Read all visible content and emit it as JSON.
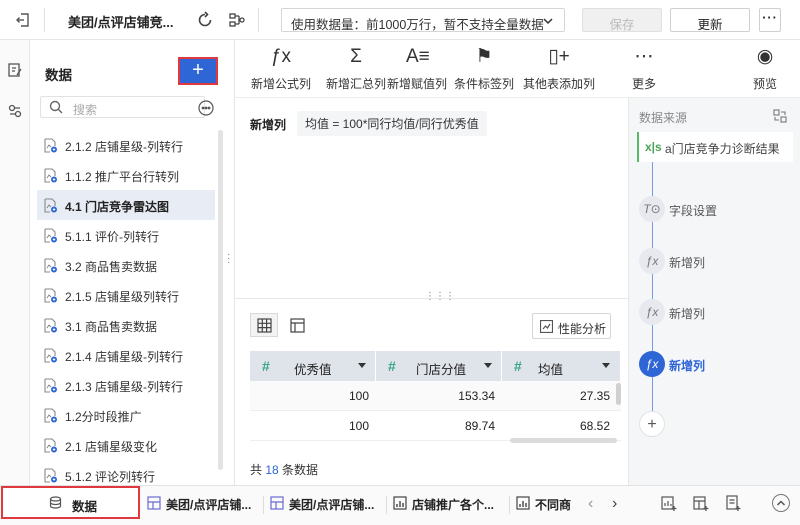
{
  "header": {
    "title": "美团/点评店铺竞...",
    "data_mode": "使用数据量：前1000万行，暂不支持全量数据",
    "save_label": "保存",
    "update_label": "更新",
    "more_label": "···"
  },
  "data_panel": {
    "heading": "数据",
    "add_label": "+",
    "search_placeholder": "搜索",
    "items": [
      {
        "label": "2.1.2 店铺星级-列转行"
      },
      {
        "label": "1.1.2 推广平台行转列"
      },
      {
        "label": "4.1 门店竞争雷达图"
      },
      {
        "label": "5.1.1 评价-列转行"
      },
      {
        "label": "3.2 商品售卖数据"
      },
      {
        "label": "2.1.5 店铺星级列转行"
      },
      {
        "label": "3.1 商品售卖数据"
      },
      {
        "label": "2.1.4 店铺星级-列转行"
      },
      {
        "label": "2.1.3 店铺星级-列转行"
      },
      {
        "label": "1.2分时段推广"
      },
      {
        "label": "2.1 店铺星级变化"
      },
      {
        "label": "5.1.2 评论列转行"
      }
    ]
  },
  "toolbar": {
    "tools": [
      {
        "label": "新增公式列",
        "glyph": "ƒx"
      },
      {
        "label": "新增汇总列",
        "glyph": "Σ"
      },
      {
        "label": "新增赋值列",
        "glyph": "A≡"
      },
      {
        "label": "条件标签列",
        "glyph": "⚑"
      },
      {
        "label": "其他表添加列",
        "glyph": "▯+"
      },
      {
        "label": "更多",
        "glyph": "⋯"
      },
      {
        "label": "预览",
        "glyph": "◉"
      }
    ]
  },
  "formula": {
    "label": "新增列",
    "value": "均值 = 100*同行均值/同行优秀值"
  },
  "preview": {
    "perf_label": "性能分析",
    "columns": [
      "优秀值",
      "门店分值",
      "均值"
    ],
    "rows": [
      [
        "100",
        "153.34",
        "27.35"
      ],
      [
        "100",
        "89.74",
        "68.52"
      ]
    ],
    "count_prefix": "共 ",
    "count_value": "18",
    "count_suffix": " 条数据"
  },
  "source": {
    "label": "数据来源",
    "file_badge": "x|s",
    "file_name": "a门店竞争力诊断结果",
    "steps": [
      {
        "label": "字段设置",
        "glyph": "T⊙"
      },
      {
        "label": "新增列",
        "glyph": "ƒx"
      },
      {
        "label": "新增列",
        "glyph": "ƒx"
      },
      {
        "label": "新增列",
        "glyph": "ƒx"
      }
    ],
    "add_label": "+"
  },
  "bottom": {
    "data_tab": "数据",
    "tabs": [
      {
        "label": "美团/点评店铺..."
      },
      {
        "label": "美团/点评店铺..."
      },
      {
        "label": "店铺推广各个..."
      },
      {
        "label": "不同商"
      }
    ]
  },
  "colors": {
    "accent": "#2f66d6",
    "highlight_border": "#e0383e",
    "number_icon": "#3aa58a"
  }
}
